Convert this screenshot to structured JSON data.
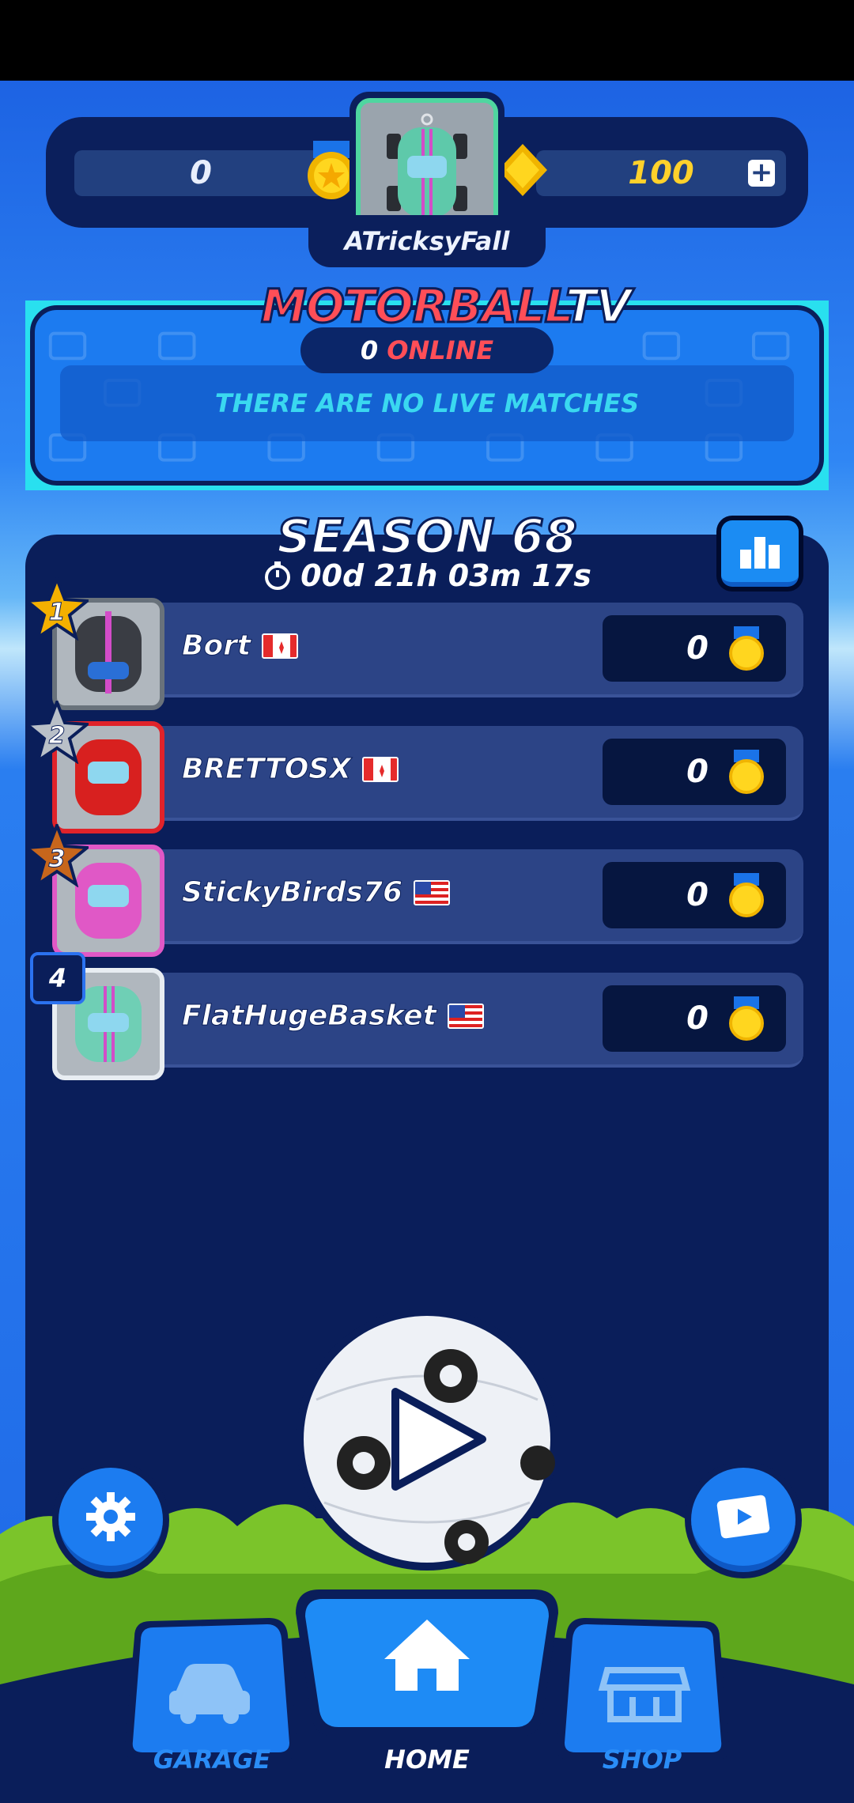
{
  "header": {
    "trophies": "0",
    "coins": "100",
    "username": "ATricksyFall",
    "add_coins_symbol": "+"
  },
  "tv": {
    "title_part1": "MOTORBALL",
    "title_part2": "TV",
    "online_count": "0",
    "online_label": "ONLINE",
    "message": "THERE ARE NO LIVE MATCHES"
  },
  "season": {
    "title": "SEASON 68",
    "timer": "00d 21h 03m 17s",
    "leaderboard": [
      {
        "rank": "1",
        "name": "Bort",
        "country": "Canada",
        "score": "0",
        "car_color": "#3a3d44"
      },
      {
        "rank": "2",
        "name": "BRETTOSX",
        "country": "Canada",
        "score": "0",
        "car_color": "#d8201f"
      },
      {
        "rank": "3",
        "name": "StickyBirds76",
        "country": "USA",
        "score": "0",
        "car_color": "#e058c6"
      },
      {
        "rank": "4",
        "name": "FlatHugeBasket",
        "country": "USA",
        "score": "0",
        "car_color": "#6fcfb5"
      }
    ]
  },
  "nav": {
    "garage": "GARAGE",
    "home": "HOME",
    "shop": "SHOP"
  },
  "colors": {
    "accent_blue": "#1c7cf0",
    "panel_dark": "#0a1e5a",
    "gold": "#ffd12b",
    "red": "#ff4e57",
    "cyan": "#3ad8f0"
  },
  "icons": [
    "medal-icon",
    "gem-icon",
    "plus-icon",
    "timer-icon",
    "leaderboard-icon",
    "gear-icon",
    "video-icon",
    "car-icon",
    "home-icon",
    "shop-icon",
    "play-icon"
  ]
}
